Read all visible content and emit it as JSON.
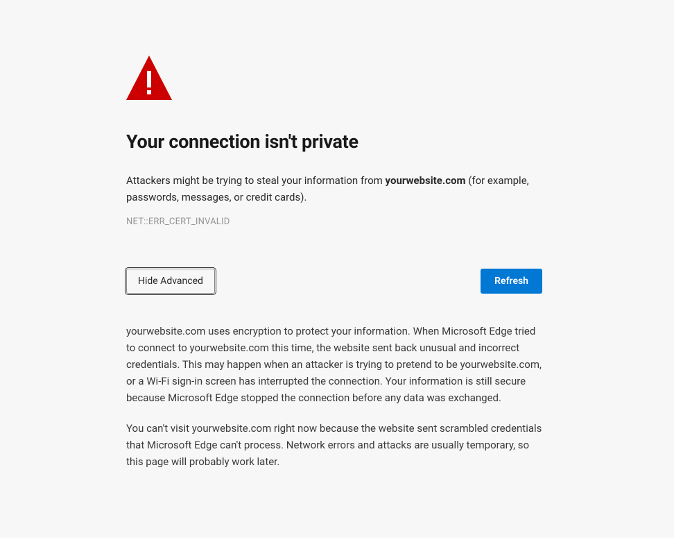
{
  "icon": {
    "name": "warning-triangle-icon",
    "fill": "#cc0000",
    "exclamation_fill": "#ffffff"
  },
  "title": "Your connection isn't private",
  "description": {
    "prefix": "Attackers might be trying to steal your information from ",
    "domain": "yourwebsite.com",
    "suffix": " (for example, passwords, messages, or credit cards)."
  },
  "error_code": "NET::ERR_CERT_INVALID",
  "buttons": {
    "advanced_label": "Hide Advanced",
    "refresh_label": "Refresh"
  },
  "details": {
    "paragraph1": "yourwebsite.com uses encryption to protect your information. When Microsoft Edge tried to connect to yourwebsite.com this time, the website sent back unusual and incorrect credentials. This may happen when an attacker is trying to pretend to be yourwebsite.com, or a Wi-Fi sign-in screen has interrupted the connection. Your information is still secure because Microsoft Edge stopped the connection before any data was exchanged.",
    "paragraph2": "You can't visit yourwebsite.com right now because the website sent scrambled credentials that Microsoft Edge can't process. Network errors and attacks are usually temporary, so this page will probably work later."
  }
}
